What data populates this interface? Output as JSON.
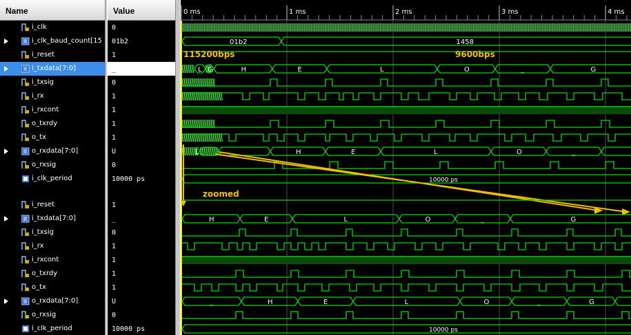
{
  "headers": {
    "name": "Name",
    "value": "Value"
  },
  "time_ticks": [
    "0 ms",
    "1 ms",
    "2 ms",
    "3 ms",
    "4 ms"
  ],
  "top_rows": [
    {
      "name": "i_clk",
      "value": "0",
      "type": "bit"
    },
    {
      "name": "i_clk_baud_count[15",
      "value": "01b2",
      "type": "bus",
      "expander": true
    },
    {
      "name": "i_reset",
      "value": "1",
      "type": "bit"
    },
    {
      "name": "i_txdata[7:0]",
      "value": "_",
      "type": "bus",
      "expander": true,
      "selected": true
    },
    {
      "name": "i_txsig",
      "value": "0",
      "type": "bit"
    },
    {
      "name": "i_rx",
      "value": "1",
      "type": "bit"
    },
    {
      "name": "i_rxcont",
      "value": "1",
      "type": "bit"
    },
    {
      "name": "o_txrdy",
      "value": "1",
      "type": "bit"
    },
    {
      "name": "o_tx",
      "value": "1",
      "type": "bit"
    },
    {
      "name": "o_rxdata[7:0]",
      "value": "U",
      "type": "bus",
      "expander": true
    },
    {
      "name": "o_rxsig",
      "value": "0",
      "type": "bit"
    },
    {
      "name": "i_clk_period",
      "value": "10000 ps",
      "type": "param"
    }
  ],
  "bottom_rows": [
    {
      "name": "i_reset",
      "value": "1",
      "type": "bit"
    },
    {
      "name": "i_txdata[7:0]",
      "value": "_",
      "type": "bus",
      "expander": true
    },
    {
      "name": "i_txsig",
      "value": "0",
      "type": "bit"
    },
    {
      "name": "i_rx",
      "value": "1",
      "type": "bit"
    },
    {
      "name": "i_rxcont",
      "value": "1",
      "type": "bit"
    },
    {
      "name": "o_txrdy",
      "value": "1",
      "type": "bit"
    },
    {
      "name": "o_tx",
      "value": "1",
      "type": "bit"
    },
    {
      "name": "o_rxdata[7:0]",
      "value": "U",
      "type": "bus",
      "expander": true
    },
    {
      "name": "o_rxsig",
      "value": "0",
      "type": "bit"
    },
    {
      "name": "i_clk_period",
      "value": "10000 ps",
      "type": "param"
    }
  ],
  "waves": {
    "baud_labels": [
      "01b2",
      "1458"
    ],
    "txdata_top": [
      "L",
      "G",
      "H",
      "E",
      "L",
      "O",
      "_",
      "G"
    ],
    "rxdata_top": [
      "L",
      "_",
      "H",
      "E",
      "L",
      "O",
      "_"
    ],
    "clk_period_label": "10000 ps",
    "txdata_bottom": [
      "H",
      "E",
      "L",
      "O",
      "_",
      "G"
    ],
    "rxdata_bottom": [
      "_",
      "H",
      "E",
      "L",
      "O",
      "_",
      "G"
    ]
  },
  "annotations": {
    "rate_fast": "115200bps",
    "rate_slow": "9600bps",
    "zoomed": "zoomed"
  },
  "colors": {
    "wave": "#00e000",
    "fill": "#005000",
    "annot": "#f0c000",
    "bus_text": "#ffffff"
  }
}
